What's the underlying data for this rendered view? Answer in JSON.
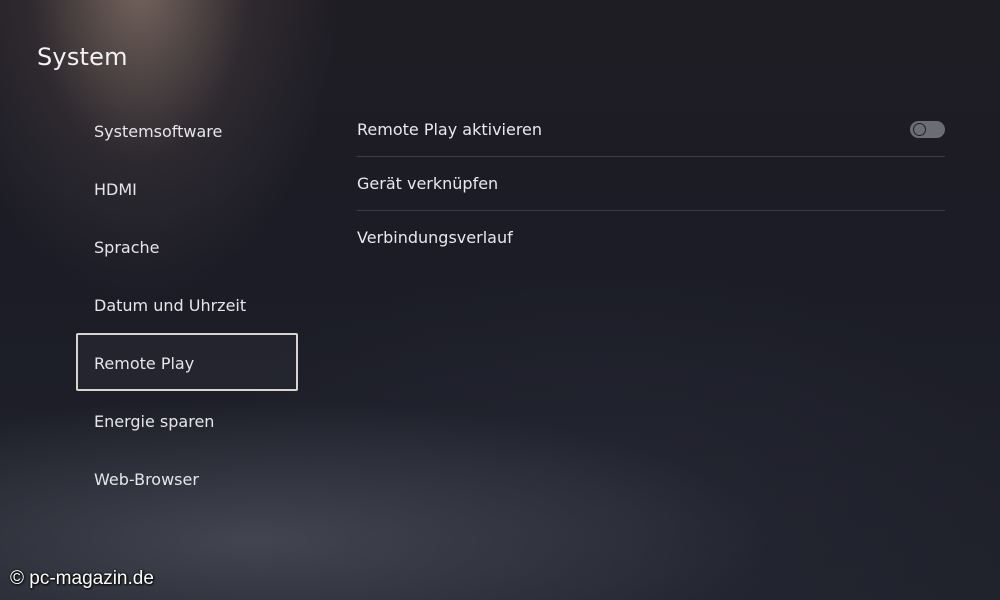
{
  "page": {
    "title": "System"
  },
  "sidebar": {
    "items": [
      {
        "label": "Systemsoftware",
        "selected": false
      },
      {
        "label": "HDMI",
        "selected": false
      },
      {
        "label": "Sprache",
        "selected": false
      },
      {
        "label": "Datum und Uhrzeit",
        "selected": false
      },
      {
        "label": "Remote Play",
        "selected": true
      },
      {
        "label": "Energie sparen",
        "selected": false
      },
      {
        "label": "Web-Browser",
        "selected": false
      }
    ]
  },
  "main": {
    "settings": [
      {
        "label": "Remote Play aktivieren",
        "control": "toggle",
        "toggle_on": false
      },
      {
        "label": "Gerät verknüpfen"
      },
      {
        "label": "Verbindungsverlauf"
      }
    ]
  },
  "watermark": {
    "text": "© pc-magazin.de"
  },
  "colors": {
    "background": "#1a1b25",
    "selection_border": "#d9d4cf",
    "toggle_off": "#6b6d76"
  }
}
